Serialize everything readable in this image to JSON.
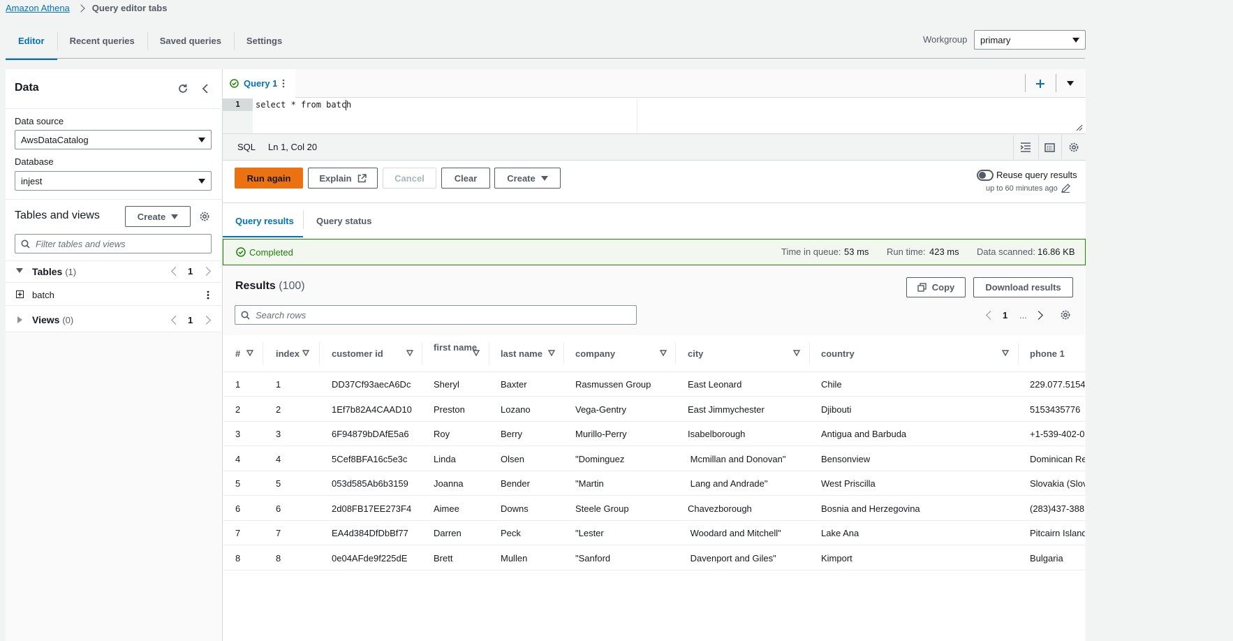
{
  "breadcrumb": {
    "root": "Amazon Athena",
    "current": "Query editor tabs"
  },
  "tabs": [
    {
      "label": "Editor"
    },
    {
      "label": "Recent queries"
    },
    {
      "label": "Saved queries"
    },
    {
      "label": "Settings"
    }
  ],
  "workgroup": {
    "label": "Workgroup",
    "value": "primary"
  },
  "data_panel": {
    "title": "Data",
    "data_source_label": "Data source",
    "data_source_value": "AwsDataCatalog",
    "database_label": "Database",
    "database_value": "injest",
    "tables_views_title": "Tables and views",
    "create_label": "Create",
    "filter_placeholder": "Filter tables and views",
    "tables_label": "Tables",
    "tables_count": "(1)",
    "tables_page": "1",
    "table_items": [
      "batch"
    ],
    "views_label": "Views",
    "views_count": "(0)",
    "views_page": "1"
  },
  "query_tab": {
    "label": "Query 1"
  },
  "editor": {
    "line": "1",
    "code": "select * from batch"
  },
  "status_bar": {
    "lang": "SQL",
    "position": "Ln 1, Col 20"
  },
  "actions": {
    "run": "Run again",
    "explain": "Explain",
    "cancel": "Cancel",
    "clear": "Clear",
    "create": "Create",
    "reuse_label": "Reuse query results",
    "reuse_sub": "up to 60 minutes ago"
  },
  "result_tabs": [
    {
      "label": "Query results"
    },
    {
      "label": "Query status"
    }
  ],
  "completion": {
    "status": "Completed",
    "queue_label": "Time in queue:",
    "queue_value": "53 ms",
    "runtime_label": "Run time:",
    "runtime_value": "423 ms",
    "scanned_label": "Data scanned:",
    "scanned_value": "16.86 KB"
  },
  "results": {
    "title": "Results",
    "count": "(100)",
    "copy": "Copy",
    "download": "Download results",
    "search_placeholder": "Search rows",
    "page": "1",
    "ellipsis": "...",
    "columns": [
      "#",
      "index",
      "customer id",
      "first name",
      "last name",
      "company",
      "city",
      "country",
      "phone 1"
    ],
    "rows": [
      [
        "1",
        "1",
        "DD37Cf93aecA6Dc",
        "Sheryl",
        "Baxter",
        "Rasmussen Group",
        "East Leonard",
        "Chile",
        "229.077.5154"
      ],
      [
        "2",
        "2",
        "1Ef7b82A4CAAD10",
        "Preston",
        "Lozano",
        "Vega-Gentry",
        "East Jimmychester",
        "Djibouti",
        "5153435776"
      ],
      [
        "3",
        "3",
        "6F94879bDAfE5a6",
        "Roy",
        "Berry",
        "Murillo-Perry",
        "Isabelborough",
        "Antigua and Barbuda",
        "+1-539-402-0"
      ],
      [
        "4",
        "4",
        "5Cef8BFA16c5e3c",
        "Linda",
        "Olsen",
        "\"Dominguez",
        " Mcmillan and Donovan\"",
        "Bensonview",
        "Dominican Re"
      ],
      [
        "5",
        "5",
        "053d585Ab6b3159",
        "Joanna",
        "Bender",
        "\"Martin",
        " Lang and Andrade\"",
        "West Priscilla",
        "Slovakia (Slov"
      ],
      [
        "6",
        "6",
        "2d08FB17EE273F4",
        "Aimee",
        "Downs",
        "Steele Group",
        "Chavezborough",
        "Bosnia and Herzegovina",
        "(283)437-388"
      ],
      [
        "7",
        "7",
        "EA4d384DfDbBf77",
        "Darren",
        "Peck",
        "\"Lester",
        " Woodard and Mitchell\"",
        "Lake Ana",
        "Pitcairn Island"
      ],
      [
        "8",
        "8",
        "0e04AFde9f225dE",
        "Brett",
        "Mullen",
        "\"Sanford",
        " Davenport and Giles\"",
        "Kimport",
        "Bulgaria"
      ]
    ]
  },
  "colors": {
    "accent": "#0073bb",
    "primary_button": "#ec7211",
    "success": "#1d8102"
  }
}
